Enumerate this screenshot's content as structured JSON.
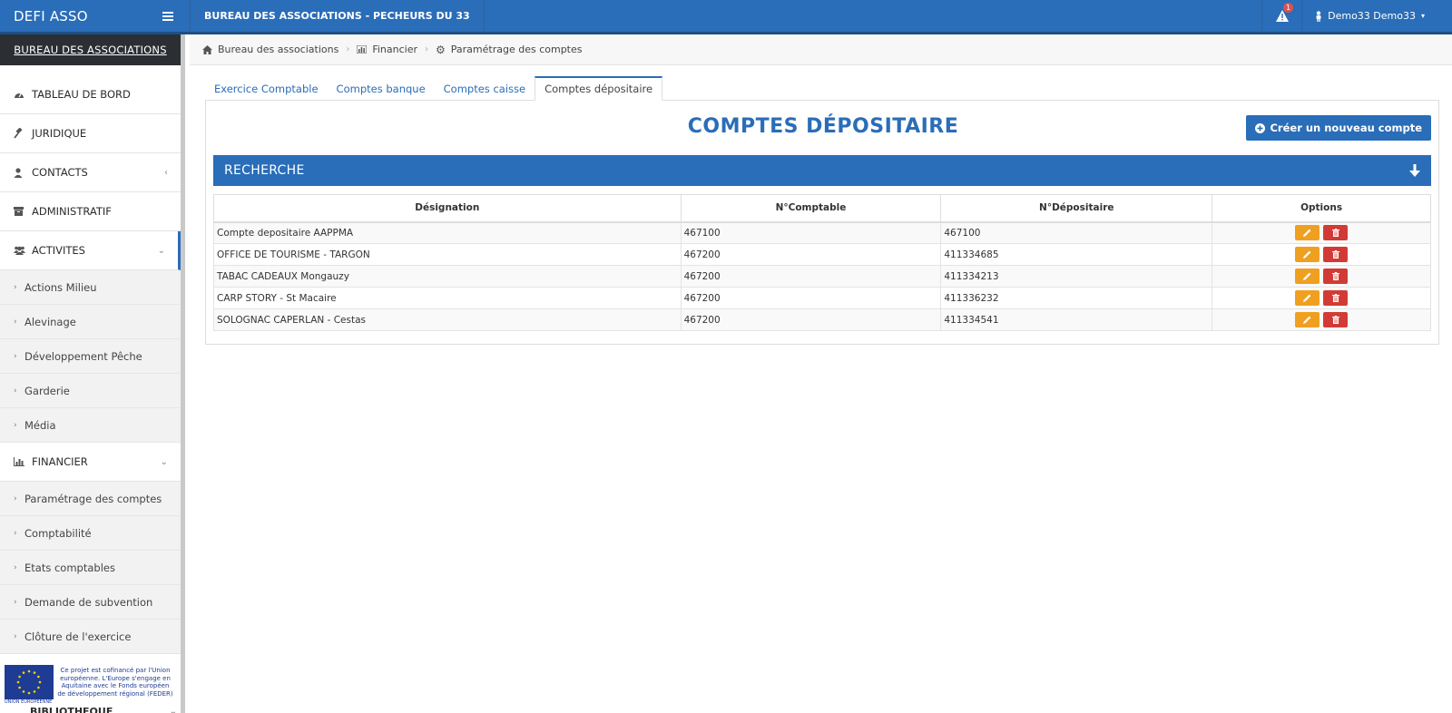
{
  "app": {
    "brand": "DEFI ASSO",
    "title": "BUREAU DES ASSOCIATIONS - PECHEURS DU 33",
    "alert_count": "1",
    "user_name": "Demo33 Demo33"
  },
  "sidebar": {
    "header": "BUREAU DES ASSOCIATIONS",
    "items": [
      {
        "label": "TABLEAU DE BORD",
        "icon": "dashboard-icon"
      },
      {
        "label": "JURIDIQUE",
        "icon": "gavel-icon"
      },
      {
        "label": "CONTACTS",
        "icon": "user-icon"
      },
      {
        "label": "ADMINISTRATIF",
        "icon": "archive-icon"
      },
      {
        "label": "ACTIVITES",
        "icon": "users-icon"
      },
      {
        "label": "FINANCIER",
        "icon": "bar-chart-icon"
      }
    ],
    "activites_sub": [
      "Actions Milieu",
      "Alevinage",
      "Développement Pêche",
      "Garderie",
      "Média"
    ],
    "financier_sub": [
      "Paramétrage des comptes",
      "Comptabilité",
      "Etats comptables",
      "Demande de subvention",
      "Clôture de l'exercice"
    ],
    "eu_text": "Ce projet est cofinancé par l'Union européenne. L'Europe s'engage en Aquitaine avec le Fonds européen de développement régional (FEDER)",
    "eu_label": "UNION EUROPEENNE",
    "partial_item": "BIBLIOTHEQUE"
  },
  "breadcrumb": [
    "Bureau des associations",
    "Financier",
    "Paramétrage des comptes"
  ],
  "tabs": [
    "Exercice Comptable",
    "Comptes banque",
    "Comptes caisse",
    "Comptes dépositaire"
  ],
  "main": {
    "title": "COMPTES DÉPOSITAIRE",
    "create_button": "Créer un nouveau compte",
    "search_label": "RECHERCHE"
  },
  "table": {
    "headers": [
      "Désignation",
      "N°Comptable",
      "N°Dépositaire",
      "Options"
    ],
    "rows": [
      [
        "Compte depositaire AAPPMA",
        "467100",
        "467100"
      ],
      [
        "OFFICE DE TOURISME - TARGON",
        "467200",
        "411334685"
      ],
      [
        "TABAC CADEAUX Mongauzy",
        "467200",
        "411334213"
      ],
      [
        "CARP STORY - St Macaire",
        "467200",
        "411336232"
      ],
      [
        "SOLOGNAC CAPERLAN - Cestas",
        "467200",
        "411334541"
      ]
    ]
  },
  "colors": {
    "primary": "#2a6db8",
    "edit": "#f0a020",
    "delete": "#d23b35",
    "sidebar_header": "#2b2f33"
  }
}
